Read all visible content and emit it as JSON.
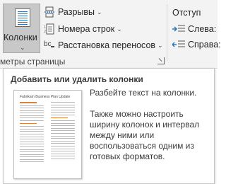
{
  "ribbon": {
    "columns_label": "Колонки",
    "breaks_label": "Разрывы",
    "line_numbers_label": "Номера строк",
    "hyphenation_label": "Расстановка переносов",
    "hyphenation_icon_text": "bc",
    "group_label": "метры страницы",
    "indent_title": "Отступ",
    "indent_left_label": "Слева:",
    "indent_right_label": "Справа:",
    "dropdown_arrow": "⌄",
    "accent_color": "#2e75b6"
  },
  "tooltip": {
    "title": "Добавить или удалить колонки",
    "thumbnail_title": "Fabrikam Business Plan Update",
    "description": "Разбейте текст на колонки.",
    "more_info": "Также можно настроить ширину колонок и интервал между ними или воспользоваться одним из готовых форматов."
  }
}
